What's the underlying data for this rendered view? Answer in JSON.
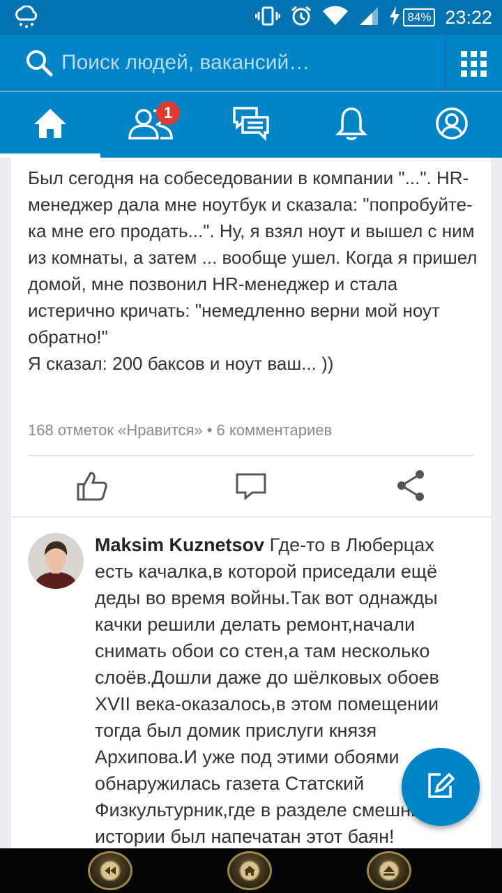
{
  "status_bar": {
    "time": "23:22",
    "battery": "84%",
    "icons": [
      "weather-rain-icon",
      "vibrate-icon",
      "alarm-icon",
      "wifi-icon",
      "signal-icon",
      "charging-icon",
      "battery-icon"
    ]
  },
  "search": {
    "placeholder": "Поиск людей, вакансий…"
  },
  "nav": {
    "tabs": [
      {
        "name": "home",
        "icon": "home-icon",
        "active": true
      },
      {
        "name": "network",
        "icon": "people-icon",
        "badge": "1"
      },
      {
        "name": "messages",
        "icon": "messages-icon"
      },
      {
        "name": "notifications",
        "icon": "bell-icon"
      },
      {
        "name": "profile",
        "icon": "profile-icon"
      }
    ]
  },
  "post": {
    "text": "Был сегодня на собеседовании в компании \"...\". HR-менеджер дала мне ноутбук и сказала: \"попробуйте-ка мне его продать...\". Ну, я взял ноут и вышел с ним из комнаты, а затем ... вообще ушел. Когда я пришел домой, мне позвонил HR-менеджер и стала истерично кричать: \"немедленно верни мой ноут обратно!\"\nЯ сказал: 200 баксов и ноут ваш... ))",
    "meta": "168 отметок «Нравится» • 6 комментариев",
    "actions": [
      "like-icon",
      "comment-icon",
      "share-icon"
    ]
  },
  "comment": {
    "author": "Maksim Kuznetsov",
    "text": "Где-то в Люберцах есть качалка,в которой приседали ещё деды во время войны.Так вот однажды качки решили делать ремонт,начали снимать обои со стен,а там несколько слоёв.Дошли даже до шёлковых обоев XVII века-оказалось,в этом помещении тогда был домик прислуги князя Архипова.И уже под этими обоями обнаружилась газета Статский Физкультурник,где в разделе смешные истории был напечатан этот баян!"
  },
  "colors": {
    "brand_blue": "#0084c8",
    "status_blue": "#0273b1",
    "badge_red": "#e03c2d"
  }
}
